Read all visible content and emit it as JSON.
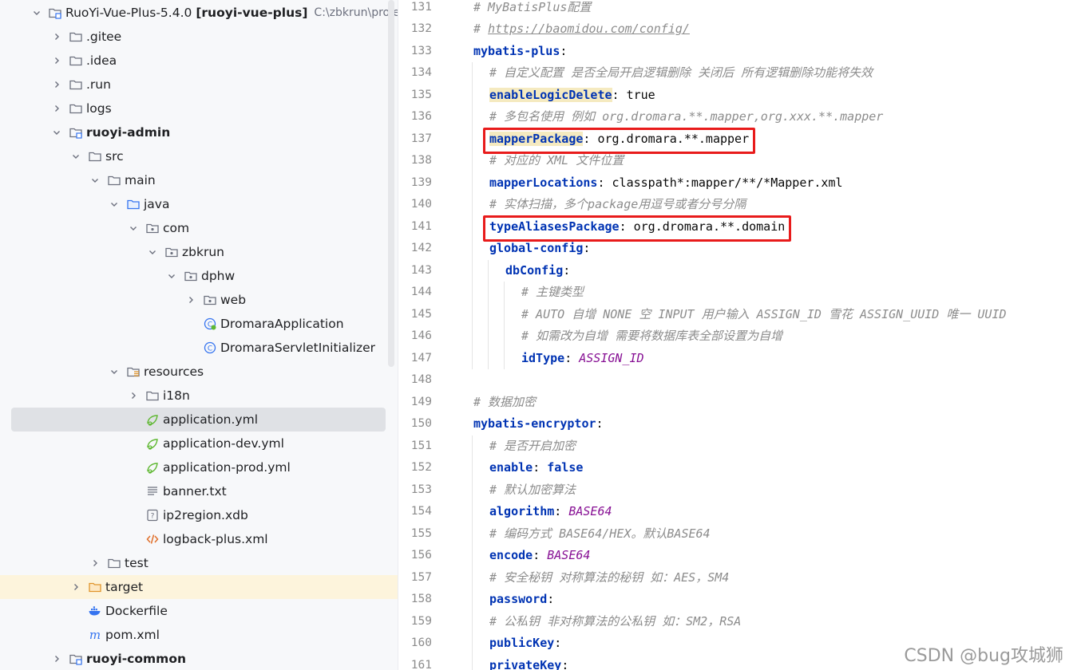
{
  "project_tree": {
    "rows": [
      {
        "label": "RuoYi-Vue-Plus-5.4.0 [ruoyi-vue-plus]",
        "path": "C:\\zbkrun\\project\\Ja",
        "icon": "module-folder-icon",
        "arrow": "down",
        "indent": 0,
        "bold": false
      },
      {
        "label": ".gitee",
        "icon": "folder-icon",
        "arrow": "right",
        "indent": 1
      },
      {
        "label": ".idea",
        "icon": "folder-icon",
        "arrow": "right",
        "indent": 1
      },
      {
        "label": ".run",
        "icon": "folder-icon",
        "arrow": "right",
        "indent": 1
      },
      {
        "label": "logs",
        "icon": "folder-icon",
        "arrow": "right",
        "indent": 1
      },
      {
        "label": "ruoyi-admin",
        "icon": "module-folder-icon",
        "arrow": "down",
        "indent": 1,
        "bold": true
      },
      {
        "label": "src",
        "icon": "folder-icon",
        "arrow": "down",
        "indent": 2
      },
      {
        "label": "main",
        "icon": "folder-icon",
        "arrow": "down",
        "indent": 3
      },
      {
        "label": "java",
        "icon": "source-folder-icon",
        "arrow": "down",
        "indent": 4
      },
      {
        "label": "com",
        "icon": "package-icon",
        "arrow": "down",
        "indent": 5
      },
      {
        "label": "zbkrun",
        "icon": "package-icon",
        "arrow": "down",
        "indent": 6
      },
      {
        "label": "dphw",
        "icon": "package-icon",
        "arrow": "down",
        "indent": 7
      },
      {
        "label": "web",
        "icon": "package-icon",
        "arrow": "right",
        "indent": 8
      },
      {
        "label": "DromaraApplication",
        "icon": "spring-class-icon",
        "arrow": "none",
        "indent": 8
      },
      {
        "label": "DromaraServletInitializer",
        "icon": "class-icon",
        "arrow": "none",
        "indent": 8
      },
      {
        "label": "resources",
        "icon": "resources-folder-icon",
        "arrow": "down",
        "indent": 4
      },
      {
        "label": "i18n",
        "icon": "folder-icon",
        "arrow": "right",
        "indent": 5
      },
      {
        "label": "application.yml",
        "icon": "spring-yml-icon",
        "arrow": "none",
        "indent": 5,
        "selected": true
      },
      {
        "label": "application-dev.yml",
        "icon": "spring-yml-icon",
        "arrow": "none",
        "indent": 5
      },
      {
        "label": "application-prod.yml",
        "icon": "spring-yml-icon",
        "arrow": "none",
        "indent": 5
      },
      {
        "label": "banner.txt",
        "icon": "text-file-icon",
        "arrow": "none",
        "indent": 5
      },
      {
        "label": "ip2region.xdb",
        "icon": "unknown-file-icon",
        "arrow": "none",
        "indent": 5
      },
      {
        "label": "logback-plus.xml",
        "icon": "xml-file-icon",
        "arrow": "none",
        "indent": 5
      },
      {
        "label": "test",
        "icon": "folder-icon",
        "arrow": "right",
        "indent": 3
      },
      {
        "label": "target",
        "icon": "excluded-folder-icon",
        "arrow": "right",
        "indent": 2,
        "highlight": true
      },
      {
        "label": "Dockerfile",
        "icon": "docker-icon",
        "arrow": "none",
        "indent": 2
      },
      {
        "label": "pom.xml",
        "icon": "maven-icon",
        "arrow": "none",
        "indent": 2
      },
      {
        "label": "ruoyi-common",
        "icon": "module-folder-icon",
        "arrow": "right",
        "indent": 1,
        "bold": true
      }
    ]
  },
  "editor": {
    "first_line": 131,
    "lines": [
      {
        "n": "131",
        "indent": 0,
        "parts": [
          {
            "t": "# MyBatisPlus配置",
            "c": "c"
          }
        ]
      },
      {
        "n": "132",
        "indent": 0,
        "parts": [
          {
            "t": "# ",
            "c": "c"
          },
          {
            "t": "https://baomidou.com/config/",
            "c": "u"
          }
        ]
      },
      {
        "n": "133",
        "indent": 0,
        "parts": [
          {
            "t": "mybatis-plus",
            "c": "k"
          },
          {
            "t": ":",
            "c": ""
          }
        ]
      },
      {
        "n": "134",
        "indent": 1,
        "parts": [
          {
            "t": "# 自定义配置 是否全局开启逻辑删除 关闭后 所有逻辑删除功能将失效",
            "c": "c"
          }
        ]
      },
      {
        "n": "135",
        "indent": 1,
        "parts": [
          {
            "t": "enableLogicDelete",
            "c": "k hlkey"
          },
          {
            "t": ": true",
            "c": ""
          }
        ]
      },
      {
        "n": "136",
        "indent": 1,
        "parts": [
          {
            "t": "# 多包名使用 例如 org.dromara.**.mapper,org.xxx.**.mapper",
            "c": "c"
          }
        ]
      },
      {
        "n": "137",
        "indent": 1,
        "parts": [
          {
            "t": "mapperPackage",
            "c": "k hlkey"
          },
          {
            "t": ": org.dromara.**.mapper",
            "c": ""
          }
        ]
      },
      {
        "n": "138",
        "indent": 1,
        "parts": [
          {
            "t": "# 对应的 XML 文件位置",
            "c": "c"
          }
        ]
      },
      {
        "n": "139",
        "indent": 1,
        "parts": [
          {
            "t": "mapperLocations",
            "c": "k"
          },
          {
            "t": ": classpath*:mapper/**/*Mapper.xml",
            "c": ""
          }
        ]
      },
      {
        "n": "140",
        "indent": 1,
        "parts": [
          {
            "t": "# 实体扫描，多个package用逗号或者分号分隔",
            "c": "c"
          }
        ]
      },
      {
        "n": "141",
        "indent": 1,
        "parts": [
          {
            "t": "typeAliasesPackage",
            "c": "k"
          },
          {
            "t": ": org.dromara.**.domain",
            "c": ""
          }
        ]
      },
      {
        "n": "142",
        "indent": 1,
        "parts": [
          {
            "t": "global-config",
            "c": "k"
          },
          {
            "t": ":",
            "c": ""
          }
        ]
      },
      {
        "n": "143",
        "indent": 2,
        "parts": [
          {
            "t": "dbConfig",
            "c": "k"
          },
          {
            "t": ":",
            "c": ""
          }
        ]
      },
      {
        "n": "144",
        "indent": 3,
        "parts": [
          {
            "t": "# 主键类型",
            "c": "c"
          }
        ]
      },
      {
        "n": "145",
        "indent": 3,
        "parts": [
          {
            "t": "# AUTO 自增 NONE 空 INPUT 用户输入 ASSIGN_ID 雪花 ASSIGN_UUID 唯一 UUID",
            "c": "c"
          }
        ]
      },
      {
        "n": "146",
        "indent": 3,
        "parts": [
          {
            "t": "# 如需改为自增 需要将数据库表全部设置为自增",
            "c": "c"
          }
        ]
      },
      {
        "n": "147",
        "indent": 3,
        "parts": [
          {
            "t": "idType",
            "c": "k"
          },
          {
            "t": ": ",
            "c": ""
          },
          {
            "t": "ASSIGN_ID",
            "c": "v"
          }
        ]
      },
      {
        "n": "148",
        "indent": 0,
        "parts": []
      },
      {
        "n": "149",
        "indent": 0,
        "parts": [
          {
            "t": "# 数据加密",
            "c": "c"
          }
        ]
      },
      {
        "n": "150",
        "indent": 0,
        "parts": [
          {
            "t": "mybatis-encryptor",
            "c": "k"
          },
          {
            "t": ":",
            "c": ""
          }
        ]
      },
      {
        "n": "151",
        "indent": 1,
        "parts": [
          {
            "t": "# 是否开启加密",
            "c": "c"
          }
        ]
      },
      {
        "n": "152",
        "indent": 1,
        "parts": [
          {
            "t": "enable",
            "c": "k"
          },
          {
            "t": ": ",
            "c": ""
          },
          {
            "t": "false",
            "c": "k"
          }
        ]
      },
      {
        "n": "153",
        "indent": 1,
        "parts": [
          {
            "t": "# 默认加密算法",
            "c": "c"
          }
        ]
      },
      {
        "n": "154",
        "indent": 1,
        "parts": [
          {
            "t": "algorithm",
            "c": "k"
          },
          {
            "t": ": ",
            "c": ""
          },
          {
            "t": "BASE64",
            "c": "v"
          }
        ]
      },
      {
        "n": "155",
        "indent": 1,
        "parts": [
          {
            "t": "# 编码方式 BASE64/HEX。默认BASE64",
            "c": "c"
          }
        ]
      },
      {
        "n": "156",
        "indent": 1,
        "parts": [
          {
            "t": "encode",
            "c": "k"
          },
          {
            "t": ": ",
            "c": ""
          },
          {
            "t": "BASE64",
            "c": "v"
          }
        ]
      },
      {
        "n": "157",
        "indent": 1,
        "parts": [
          {
            "t": "# 安全秘钥 对称算法的秘钥 如：AES，SM4",
            "c": "c"
          }
        ]
      },
      {
        "n": "158",
        "indent": 1,
        "parts": [
          {
            "t": "password",
            "c": "k"
          },
          {
            "t": ":",
            "c": ""
          }
        ]
      },
      {
        "n": "159",
        "indent": 1,
        "parts": [
          {
            "t": "# 公私钥 非对称算法的公私钥 如：SM2，RSA",
            "c": "c"
          }
        ]
      },
      {
        "n": "160",
        "indent": 1,
        "parts": [
          {
            "t": "publicKey",
            "c": "k"
          },
          {
            "t": ":",
            "c": ""
          }
        ]
      },
      {
        "n": "161",
        "indent": 1,
        "parts": [
          {
            "t": "privateKey",
            "c": "k"
          },
          {
            "t": ":",
            "c": ""
          }
        ]
      }
    ],
    "red_boxed_lines": [
      "137",
      "141"
    ]
  },
  "watermark": "CSDN @bug攻城狮"
}
